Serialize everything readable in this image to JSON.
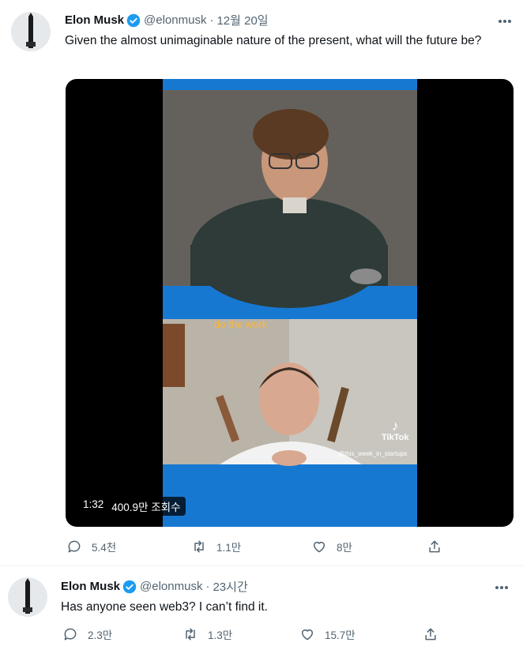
{
  "tweets": [
    {
      "name": "Elon Musk",
      "handle": "@elonmusk",
      "separator": "·",
      "time": "12월 20일",
      "text": "Given the almost unimaginable nature of the present, what will the future be?",
      "media": {
        "duration": "1:32",
        "views": "400.9만 조회수",
        "caption_overlay": "do the work",
        "watermark_brand": "TikTok",
        "watermark_handle": "@this_week_in_startups"
      },
      "actions": {
        "reply": "5.4천",
        "retweet": "1.1만",
        "like": "8만"
      }
    },
    {
      "name": "Elon Musk",
      "handle": "@elonmusk",
      "separator": "·",
      "time": "23시간",
      "text": "Has anyone seen web3? I can’t find it.",
      "actions": {
        "reply": "2.3만",
        "retweet": "1.3만",
        "like": "15.7만"
      }
    }
  ],
  "colors": {
    "accent": "#1d9bf0",
    "secondary_text": "#536471",
    "video_blue": "#1778d2"
  },
  "icons": [
    "verified-badge-icon",
    "more-icon",
    "reply-icon",
    "retweet-icon",
    "like-icon",
    "share-icon",
    "tiktok-icon"
  ]
}
